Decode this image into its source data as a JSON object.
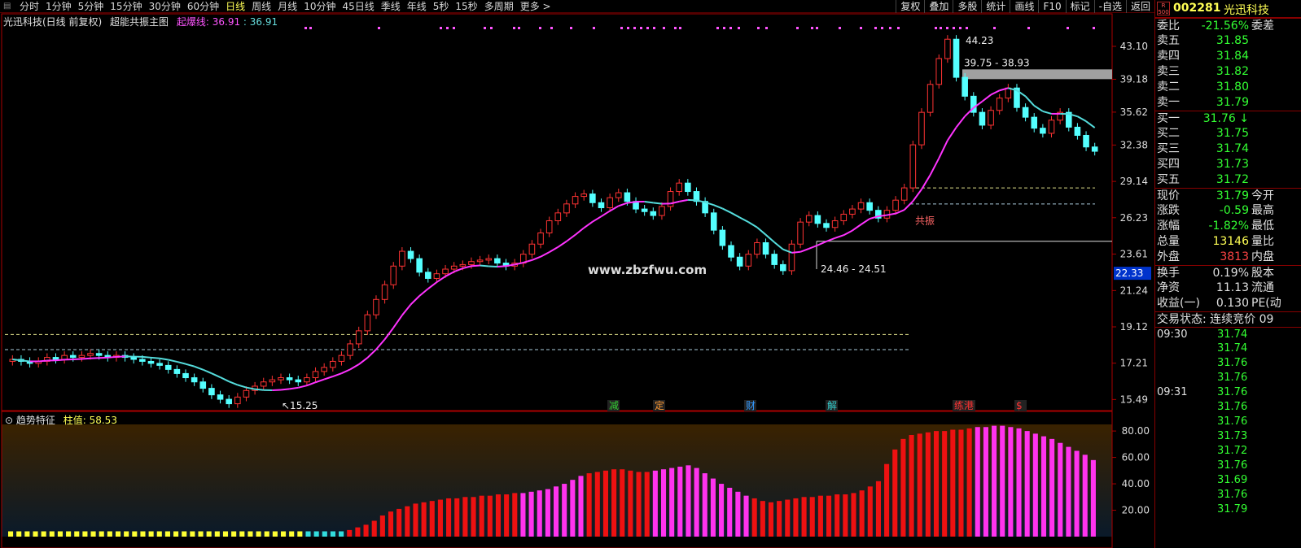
{
  "toolbar": {
    "items": [
      "分时",
      "1分钟",
      "5分钟",
      "15分钟",
      "30分钟",
      "60分钟",
      "日线",
      "周线",
      "月线",
      "10分钟",
      "45日线",
      "季线",
      "年线",
      "5秒",
      "15秒",
      "多周期",
      "更多 >"
    ],
    "active": "日线",
    "right_items": [
      "复权",
      "叠加",
      "多股",
      "统计",
      "画线",
      "F10",
      "标记",
      "-自选",
      "返回"
    ]
  },
  "main_panel": {
    "stock_label": "光迅科技(日线 前复权)",
    "indicator_name": "超能共振主图",
    "line_label": "起爆线:",
    "line_value_1": "36.91",
    "line_value_2": "36.91",
    "price_axis": [
      "43.10",
      "39.18",
      "35.62",
      "32.38",
      "29.14",
      "26.23",
      "23.61",
      "21.24",
      "19.12",
      "17.21",
      "15.49"
    ],
    "current_price_tag": "22.33",
    "annotations": {
      "high": "44.23",
      "box_range": "39.75 - 38.93",
      "low_range": "24.46 - 24.51",
      "low": "15.25",
      "resonance": "共振"
    },
    "event_tags": [
      {
        "text": "减",
        "color": "#33cc33"
      },
      {
        "text": "定",
        "color": "#ff9933"
      },
      {
        "text": "财",
        "color": "#3399ff"
      },
      {
        "text": "解",
        "color": "#33cccc"
      },
      {
        "text": "练港",
        "color": "#ff3333"
      },
      {
        "text": "$",
        "color": "#ff3333"
      }
    ],
    "watermark": "www.zbzfwu.com"
  },
  "sub_panel": {
    "name": "趋势特征",
    "value_label": "柱值:",
    "value": "58.53",
    "axis": [
      "80.00",
      "60.00",
      "40.00",
      "20.00"
    ]
  },
  "chart_data": {
    "type": "candlestick",
    "series": [
      {
        "name": "起爆线",
        "color": "#ff33ff"
      }
    ],
    "y_range": [
      15.0,
      45.5
    ],
    "sub_y_range": [
      0,
      85
    ],
    "close_approx": [
      17.4,
      17.3,
      17.2,
      17.3,
      17.5,
      17.4,
      17.6,
      17.5,
      17.6,
      17.7,
      17.6,
      17.5,
      17.6,
      17.5,
      17.4,
      17.3,
      17.2,
      17.1,
      16.9,
      16.7,
      16.5,
      16.3,
      16.0,
      15.7,
      15.5,
      15.3,
      15.6,
      15.9,
      16.1,
      16.3,
      16.4,
      16.5,
      16.4,
      16.3,
      16.5,
      16.8,
      17.0,
      17.3,
      17.6,
      18.2,
      18.9,
      19.8,
      20.7,
      21.6,
      22.8,
      23.8,
      23.3,
      22.4,
      22.0,
      22.3,
      22.6,
      22.8,
      22.9,
      23.1,
      23.2,
      23.3,
      23.0,
      22.8,
      23.0,
      23.6,
      24.3,
      25.1,
      26.0,
      26.6,
      27.3,
      27.9,
      28.1,
      27.4,
      27.0,
      27.8,
      28.2,
      27.5,
      26.9,
      26.7,
      26.4,
      27.1,
      28.3,
      29.0,
      28.3,
      27.5,
      26.6,
      25.3,
      24.2,
      23.4,
      22.8,
      23.6,
      24.4,
      23.6,
      22.9,
      22.5,
      24.3,
      25.9,
      26.4,
      25.8,
      25.5,
      26.0,
      26.5,
      26.9,
      27.4,
      26.8,
      26.2,
      26.8,
      27.6,
      28.6,
      32.4,
      35.6,
      38.6,
      41.6,
      44.0,
      39.4,
      37.3,
      35.6,
      34.3,
      35.8,
      37.1,
      38.2,
      36.1,
      35.1,
      34.0,
      33.5,
      34.8,
      35.6,
      34.1,
      33.3,
      32.2,
      31.8
    ],
    "sub_values": [
      4,
      4,
      4,
      4,
      4,
      4,
      4,
      4,
      4,
      4,
      4,
      4,
      4,
      4,
      4,
      4,
      4,
      4,
      4,
      4,
      4,
      4,
      4,
      4,
      4,
      4,
      4,
      4,
      4,
      4,
      4,
      4,
      4,
      4,
      4,
      4,
      4,
      4,
      4,
      4,
      4,
      5,
      7,
      9,
      12,
      16,
      19,
      21,
      23,
      25,
      26,
      27,
      28,
      29,
      29,
      30,
      30,
      31,
      31,
      32,
      32,
      33,
      33,
      34,
      35,
      36,
      38,
      40,
      43,
      46,
      48,
      49,
      50,
      51,
      51,
      50,
      49,
      49,
      50,
      51,
      52,
      53,
      54,
      52,
      48,
      44,
      40,
      37,
      34,
      31,
      29,
      27,
      26,
      27,
      28,
      29,
      30,
      30,
      31,
      31,
      32,
      32,
      33,
      35,
      38,
      42,
      55,
      66,
      74,
      77,
      78,
      79,
      80,
      80,
      81,
      81,
      82,
      83,
      83,
      84,
      84,
      83,
      82,
      80,
      78,
      76,
      74,
      71,
      68,
      65,
      62,
      58
    ]
  }
}
